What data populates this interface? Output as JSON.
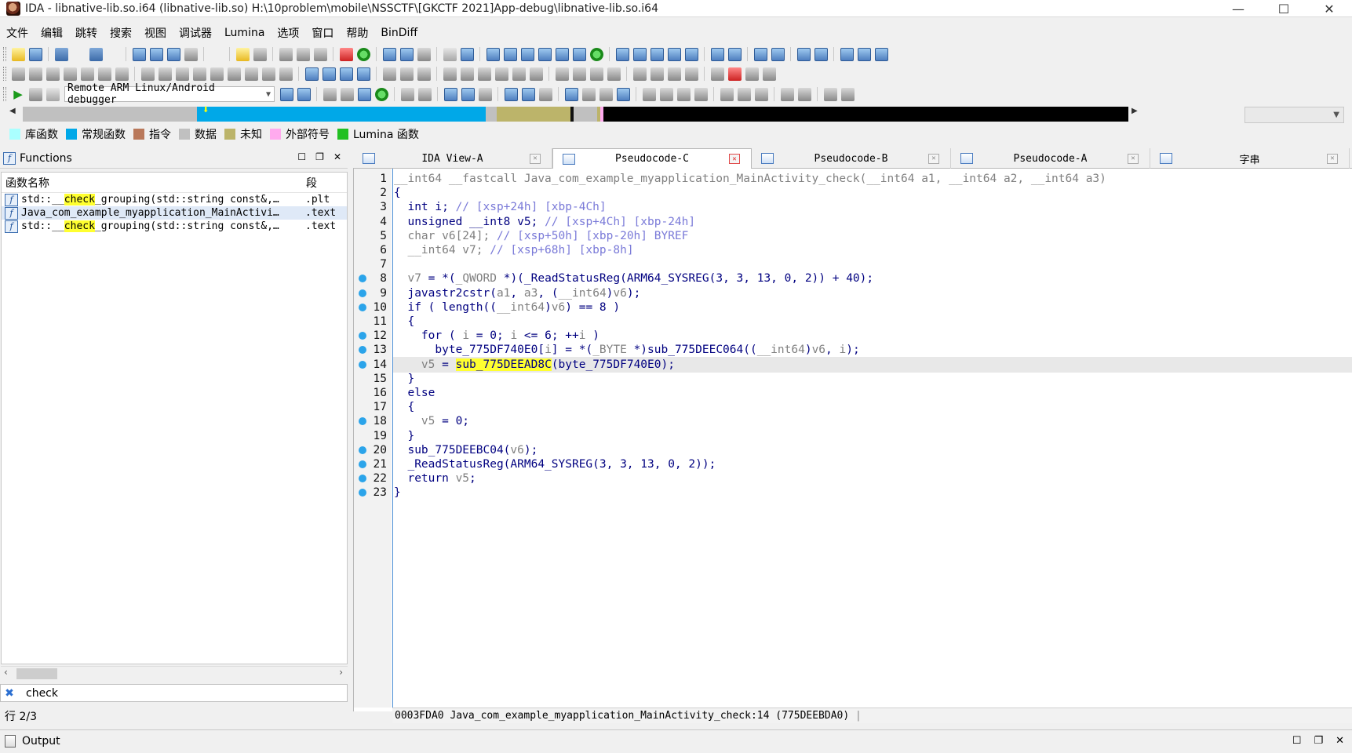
{
  "window": {
    "title": "IDA - libnative-lib.so.i64 (libnative-lib.so) H:\\10problem\\mobile\\NSSCTF\\[GKCTF 2021]App-debug\\libnative-lib.so.i64",
    "minimize": "—",
    "maximize": "☐",
    "close": "✕"
  },
  "menu": [
    "文件",
    "编辑",
    "跳转",
    "搜索",
    "视图",
    "调试器",
    "Lumina",
    "选项",
    "窗口",
    "帮助",
    "BinDiff"
  ],
  "debugger": {
    "selected": "Remote ARM Linux/Android debugger"
  },
  "legend": [
    {
      "label": "库函数",
      "color": "#aaffff"
    },
    {
      "label": "常规函数",
      "color": "#00a8e8"
    },
    {
      "label": "指令",
      "color": "#b9785a"
    },
    {
      "label": "数据",
      "color": "#c0c0c0"
    },
    {
      "label": "未知",
      "color": "#bcb46a"
    },
    {
      "label": "外部符号",
      "color": "#ffaaee"
    },
    {
      "label": "Lumina 函数",
      "color": "#22c022"
    }
  ],
  "functions": {
    "title": "Functions",
    "col_name": "函数名称",
    "col_seg": "段",
    "rows": [
      {
        "pre": "std::__",
        "hl": "check",
        "post": "_grouping(std::string const&,…",
        "seg": ".plt"
      },
      {
        "pre": "Java_com_example_myapplication_MainActivi…",
        "hl": "",
        "post": "",
        "seg": ".text"
      },
      {
        "pre": "std::__",
        "hl": "check",
        "post": "_grouping(std::string const&,…",
        "seg": ".text"
      }
    ],
    "filter": "check",
    "count": "行 2/3"
  },
  "tabs": [
    {
      "label": "IDA View-A",
      "active": false
    },
    {
      "label": "Pseudocode-C",
      "active": true
    },
    {
      "label": "Pseudocode-B",
      "active": false
    },
    {
      "label": "Pseudocode-A",
      "active": false
    },
    {
      "label": "字串",
      "active": false
    }
  ],
  "code": {
    "current_line": 14,
    "lines": [
      {
        "n": "1",
        "bp": false,
        "html": "<span class='g'>__int64 __fastcall Java_com_example_myapplication_MainActivity_check(__int64 a1, __int64 a2, __int64 a3)</span>"
      },
      {
        "n": "2",
        "bp": false,
        "html": "{"
      },
      {
        "n": "3",
        "bp": false,
        "html": "  int i; <span class='cm'>// [xsp+24h] [xbp-4Ch]</span>"
      },
      {
        "n": "4",
        "bp": false,
        "html": "  unsigned __int8 v5; <span class='cm'>// [xsp+4Ch] [xbp-24h]</span>"
      },
      {
        "n": "5",
        "bp": false,
        "html": "<span class='g'>  char v6[24]; </span><span class='cm'>// [xsp+50h] [xbp-20h] BYREF</span>"
      },
      {
        "n": "6",
        "bp": false,
        "html": "<span class='g'>  __int64 v7; </span><span class='cm'>// [xsp+68h] [xbp-8h]</span>"
      },
      {
        "n": "7",
        "bp": false,
        "html": ""
      },
      {
        "n": "8",
        "bp": true,
        "html": "  <span class='g'>v7</span> = *(<span class='g'>_QWORD</span> *)(_ReadStatusReg(ARM64_SYSREG(3, 3, 13, 0, 2)) + 40);"
      },
      {
        "n": "9",
        "bp": true,
        "html": "  javastr2cstr(<span class='g'>a1</span>, <span class='g'>a3</span>, (<span class='g'>__int64</span>)<span class='g'>v6</span>);"
      },
      {
        "n": "10",
        "bp": true,
        "html": "  if ( length((<span class='g'>__int64</span>)<span class='g'>v6</span>) == 8 )"
      },
      {
        "n": "11",
        "bp": false,
        "html": "  {"
      },
      {
        "n": "12",
        "bp": true,
        "html": "    for ( <span class='g'>i</span> = 0; <span class='g'>i</span> &lt;= 6; ++<span class='g'>i</span> )"
      },
      {
        "n": "13",
        "bp": true,
        "html": "      byte_775DF740E0[<span class='g'>i</span>] = *(<span class='g'>_BYTE</span> *)sub_775DEEC064((<span class='g'>__int64</span>)<span class='g'>v6</span>, <span class='g'>i</span>);"
      },
      {
        "n": "14",
        "bp": true,
        "html": "    <span class='g'>v5</span> = <span class='hl'>sub_775DEEAD8C</span>(byte_775DF740E0);"
      },
      {
        "n": "15",
        "bp": false,
        "html": "  }"
      },
      {
        "n": "16",
        "bp": false,
        "html": "  else"
      },
      {
        "n": "17",
        "bp": false,
        "html": "  {"
      },
      {
        "n": "18",
        "bp": true,
        "html": "    <span class='g'>v5</span> = 0;"
      },
      {
        "n": "19",
        "bp": false,
        "html": "  }"
      },
      {
        "n": "20",
        "bp": true,
        "html": "  sub_775DEEBC04(<span class='g'>v6</span>);"
      },
      {
        "n": "21",
        "bp": true,
        "html": "  _ReadStatusReg(ARM64_SYSREG(3, 3, 13, 0, 2));"
      },
      {
        "n": "22",
        "bp": true,
        "html": "  return <span class='g'>v5</span>;"
      },
      {
        "n": "23",
        "bp": true,
        "html": "}"
      }
    ],
    "status_addr": "0003FDA0",
    "status_loc": "Java_com_example_myapplication_MainActivity_check:14 (775DEEBDA0)"
  },
  "output": {
    "title": "Output"
  }
}
